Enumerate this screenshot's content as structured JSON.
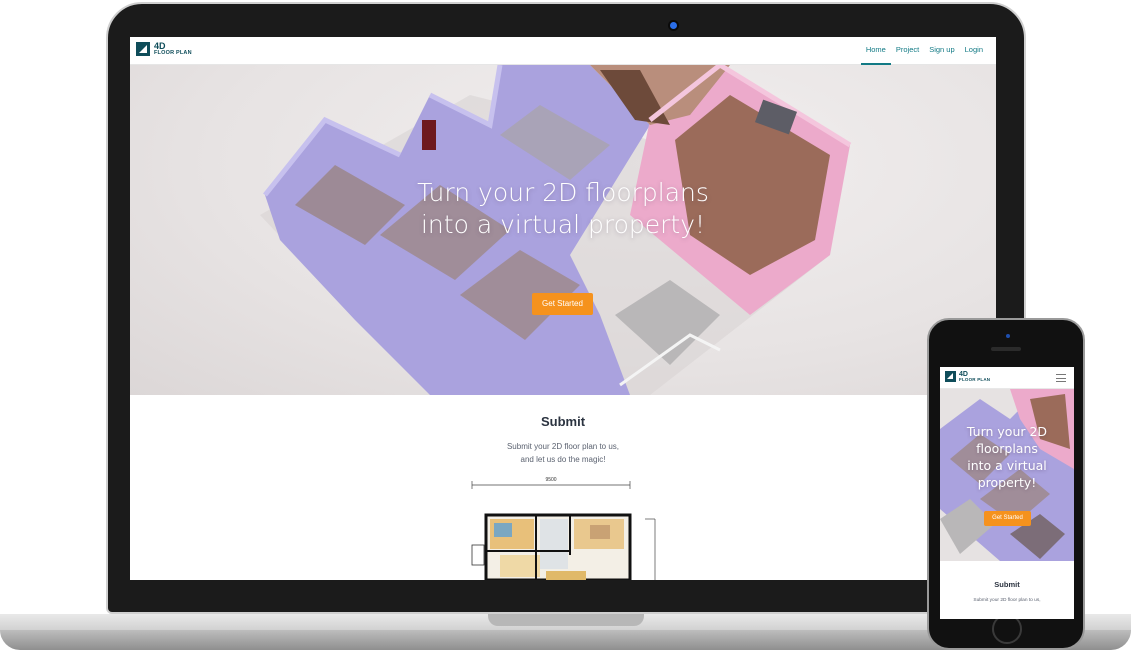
{
  "brand": {
    "line1": "4D",
    "line2": "FLOOR PLAN"
  },
  "nav": {
    "items": [
      {
        "label": "Home",
        "active": true
      },
      {
        "label": "Project",
        "active": false
      },
      {
        "label": "Sign up",
        "active": false
      },
      {
        "label": "Login",
        "active": false
      }
    ]
  },
  "hero": {
    "title_line1": "Turn your 2D floorplans",
    "title_line2": "into a virtual property!",
    "cta_label": "Get Started"
  },
  "submit": {
    "heading": "Submit",
    "text_line1": "Submit your 2D floor plan to us,",
    "text_line2": "and let us do the magic!",
    "plan_dimension": "9500"
  },
  "mobile": {
    "title_line1": "Turn your 2D",
    "title_line2": "floorplans",
    "title_line3": "into a virtual",
    "title_line4": "property!",
    "cta_label": "Get Started",
    "submit_heading": "Submit",
    "submit_text": "Submit your 2D floor plan to us,"
  },
  "colors": {
    "brand": "#0f4d5a",
    "nav_link": "#127a85",
    "cta": "#f5921d",
    "wall_purple": "#a9a1dc",
    "wall_pink": "#e9a6c8"
  }
}
